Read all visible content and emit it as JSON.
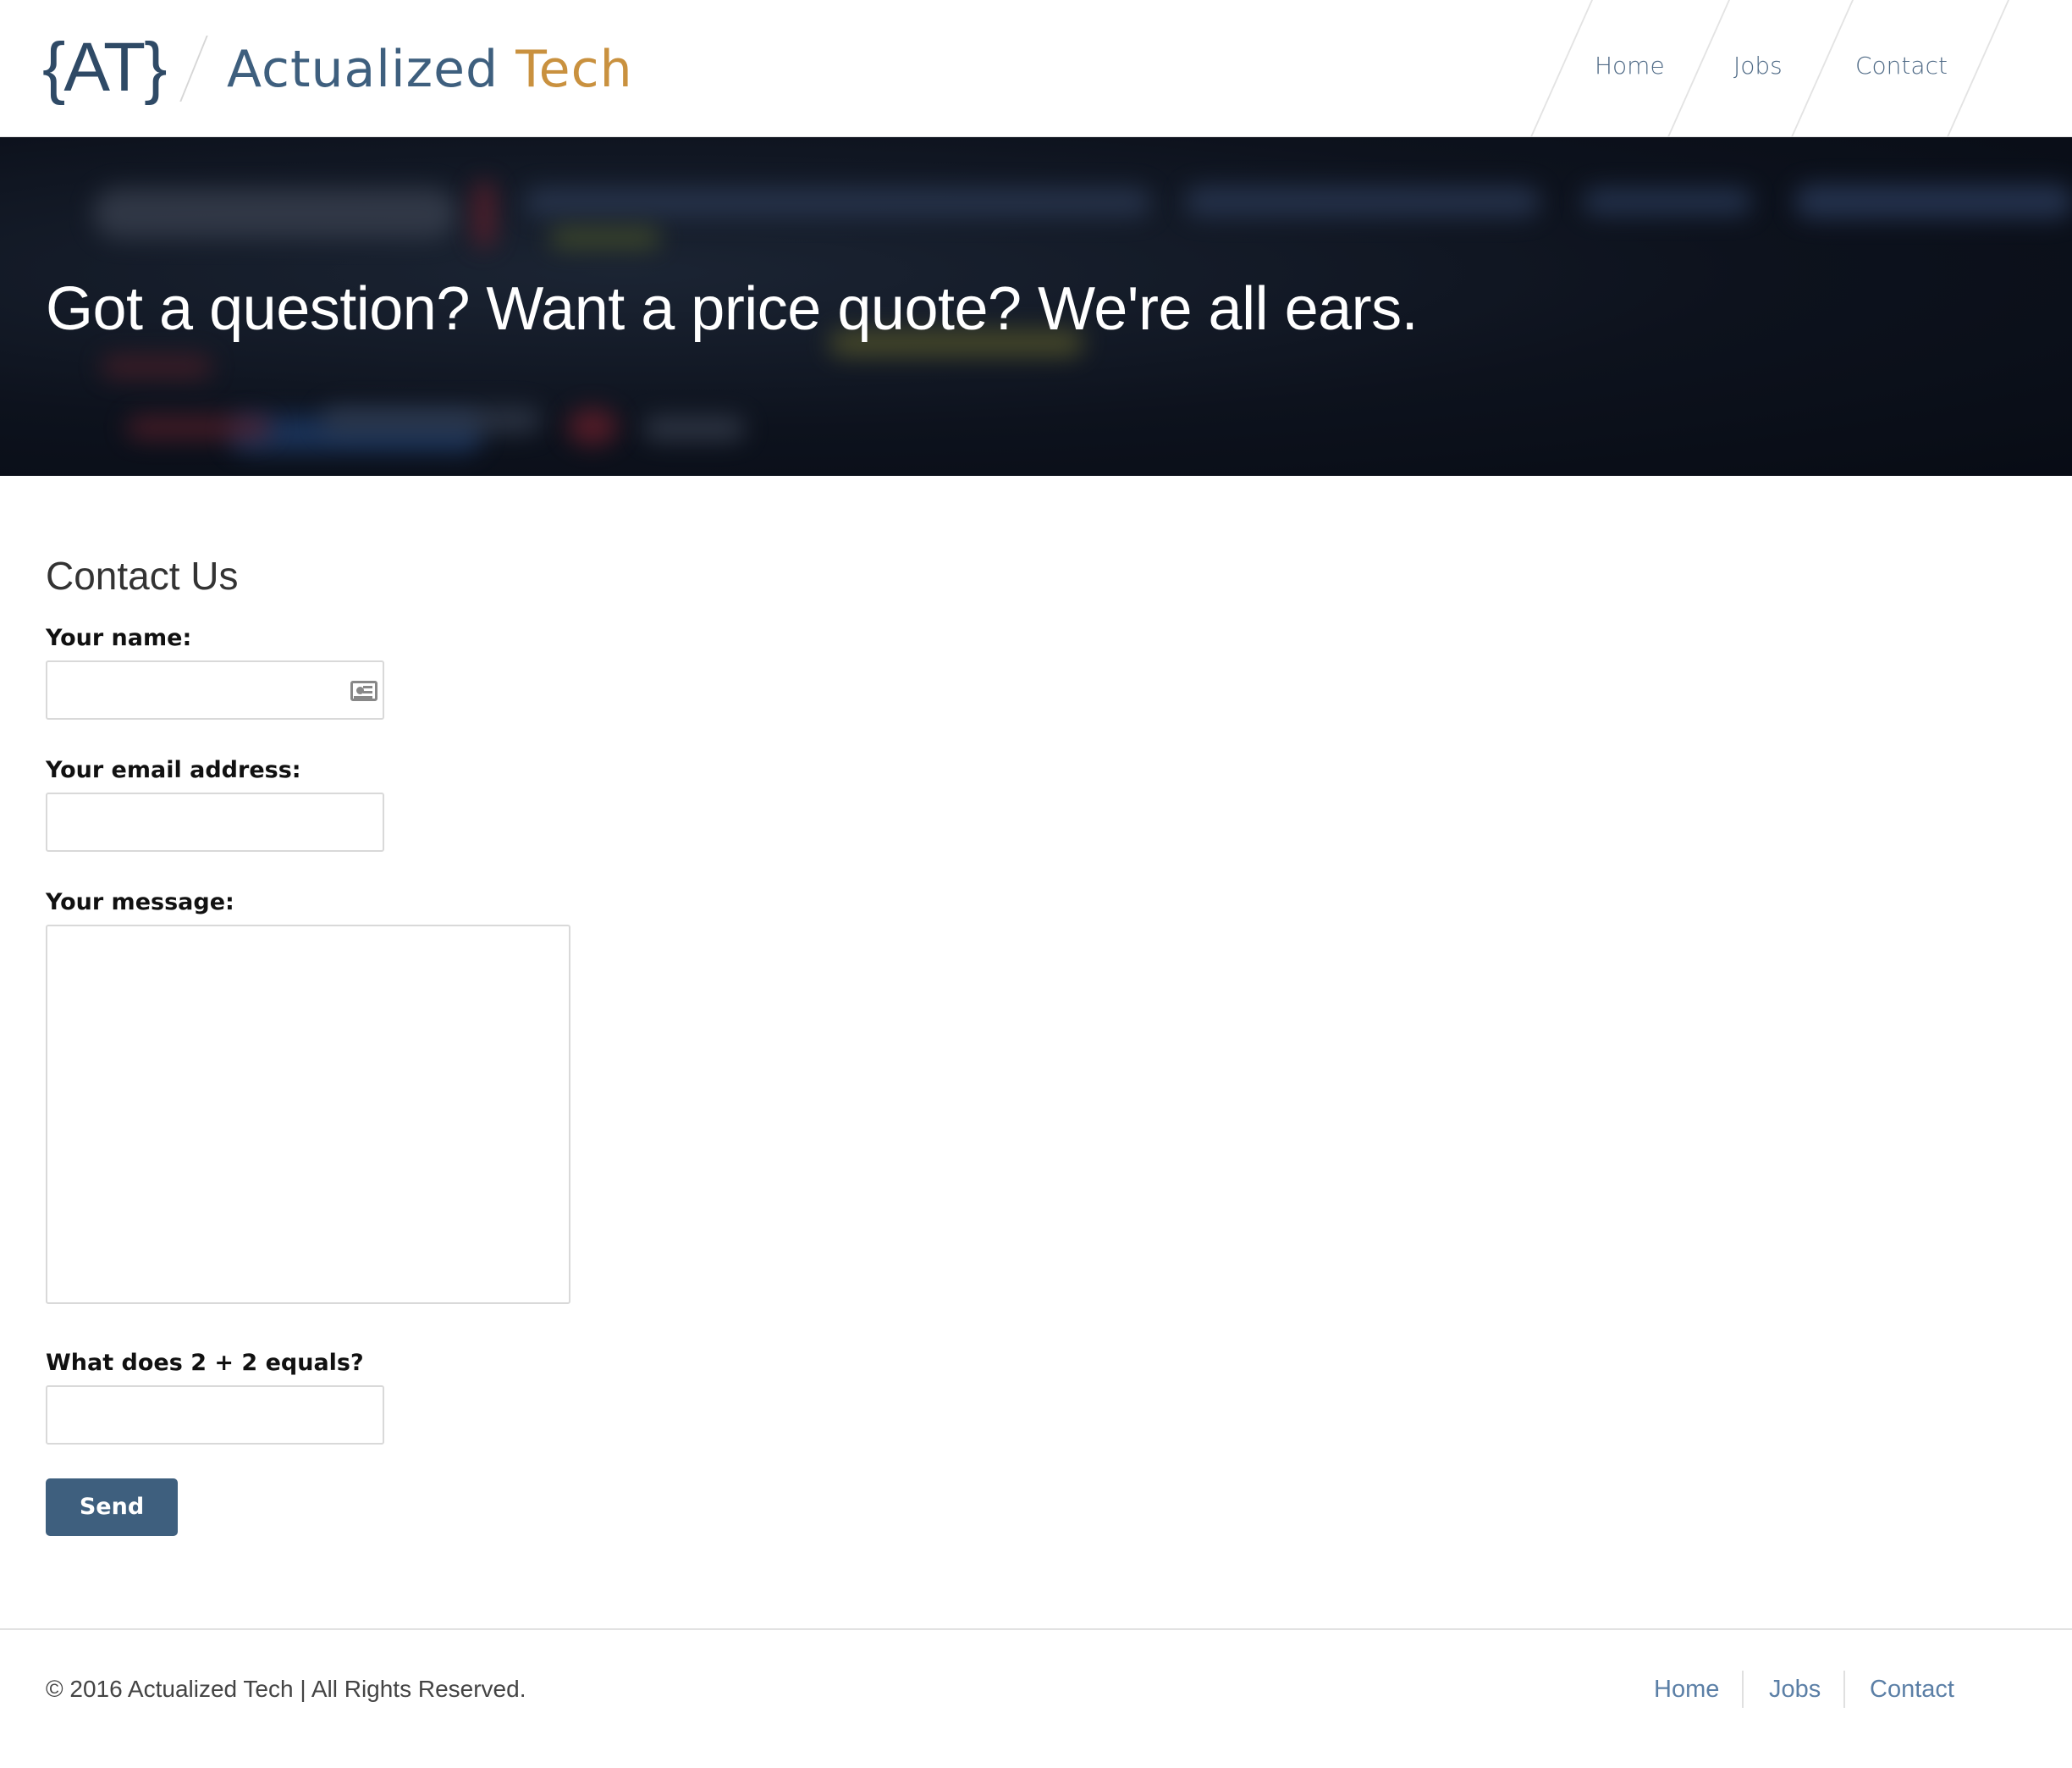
{
  "header": {
    "logo_mark": "{AT}",
    "brand_primary": "Actualized ",
    "brand_accent": "Tech",
    "nav": [
      {
        "label": "Home"
      },
      {
        "label": "Jobs"
      },
      {
        "label": "Contact"
      }
    ]
  },
  "hero": {
    "title": "Got a question? Want a price quote? We're all ears."
  },
  "form": {
    "title": "Contact Us",
    "name_label": "Your name:",
    "name_value": "",
    "email_label": "Your email address:",
    "email_value": "",
    "message_label": "Your message:",
    "message_value": "",
    "captcha_label": "What does 2 + 2 equals?",
    "captcha_value": "",
    "submit_label": "Send"
  },
  "footer": {
    "copyright": "© 2016 Actualized Tech | All Rights Reserved.",
    "links": [
      {
        "label": "Home"
      },
      {
        "label": "Jobs"
      },
      {
        "label": "Contact"
      }
    ]
  },
  "colors": {
    "brand": "#3e5f7e",
    "accent": "#c9913f",
    "link": "#5b7fa6"
  }
}
